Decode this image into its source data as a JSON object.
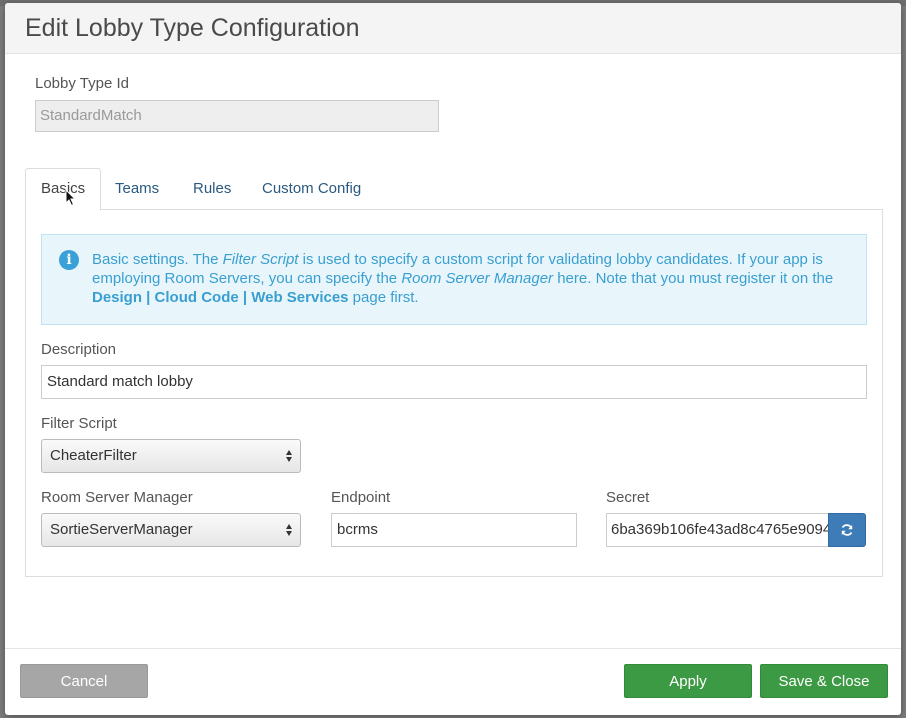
{
  "modal": {
    "title": "Edit Lobby Type Configuration"
  },
  "lobby_type_id": {
    "label": "Lobby Type Id",
    "value": "StandardMatch"
  },
  "tabs": [
    {
      "label": "Basics",
      "active": true
    },
    {
      "label": "Teams",
      "active": false
    },
    {
      "label": "Rules",
      "active": false
    },
    {
      "label": "Custom Config",
      "active": false
    }
  ],
  "info": {
    "icon": "info-icon",
    "text_1": "Basic settings. The ",
    "text_filter_script": "Filter Script",
    "text_2": " is used to specify a custom script for validating lobby candidates. If your app is employing Room Servers, you can specify the ",
    "text_room_server_manager": "Room Server Manager",
    "text_3": " here. Note that you must register it on the ",
    "text_link": "Design | Cloud Code | Web Services",
    "text_4": " page first."
  },
  "description": {
    "label": "Description",
    "value": "Standard match lobby"
  },
  "filter_script": {
    "label": "Filter Script",
    "selected": "CheaterFilter"
  },
  "room_server_manager": {
    "label": "Room Server Manager",
    "selected": "SortieServerManager"
  },
  "endpoint": {
    "label": "Endpoint",
    "value": "bcrms"
  },
  "secret": {
    "label": "Secret",
    "value": "6ba369b106fe43ad8c4765e9094",
    "refresh_icon": "refresh-icon"
  },
  "footer": {
    "cancel_label": "Cancel",
    "apply_label": "Apply",
    "save_close_label": "Save & Close"
  },
  "colors": {
    "primary_green": "#3d9a44",
    "cancel_gray": "#a6a6a6",
    "info_blue": "#3a9fd0",
    "refresh_blue": "#3e7cb8"
  }
}
